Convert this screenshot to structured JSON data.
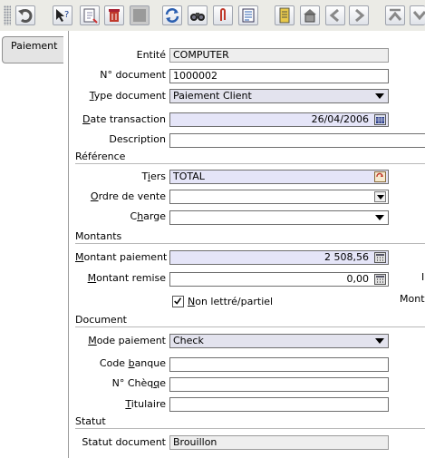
{
  "tabs": [
    {
      "label": "Paiement"
    }
  ],
  "fields": {
    "entite": {
      "label": "Entité",
      "value": "COMPUTER"
    },
    "num_document": {
      "label": "N° document",
      "value": "1000002"
    },
    "type_document": {
      "label": "Type document",
      "value": "Paiement Client"
    },
    "date_transaction": {
      "label": "Date transaction",
      "value": "26/04/2006"
    },
    "description": {
      "label": "Description",
      "value": ""
    },
    "tiers": {
      "label": "Tiers",
      "value": "TOTAL"
    },
    "ordre_vente": {
      "label": "Ordre de vente",
      "value": ""
    },
    "charge": {
      "label": "Charge",
      "value": ""
    },
    "montant_paiement": {
      "label": "Montant paiement",
      "value": "2 508,56"
    },
    "montant_remise": {
      "label": "Montant remise",
      "value": "0,00"
    },
    "non_lettre": {
      "label": "Non lettré/partiel",
      "checked": true
    },
    "mode_paiement": {
      "label": "Mode paiement",
      "value": "Check"
    },
    "code_banque": {
      "label": "Code banque",
      "value": ""
    },
    "num_cheque": {
      "label": "N° Chèque",
      "value": ""
    },
    "titulaire": {
      "label": "Titulaire",
      "value": ""
    },
    "statut_document": {
      "label": "Statut document",
      "value": "Brouillon"
    }
  },
  "sections": {
    "reference": "Référence",
    "montants": "Montants",
    "document": "Document",
    "statut": "Statut"
  },
  "cutoff": {
    "right_mid": "I",
    "right_mont": "Mont"
  },
  "toolbar": {
    "icons": [
      "undo-icon",
      "help-icon",
      "new-record-icon",
      "delete-icon",
      "save-icon",
      "refresh-icon",
      "find-icon",
      "attachment-icon",
      "report-icon",
      "history-icon",
      "archive-icon",
      "previous-icon",
      "next-icon",
      "first-icon",
      "last-icon"
    ]
  }
}
